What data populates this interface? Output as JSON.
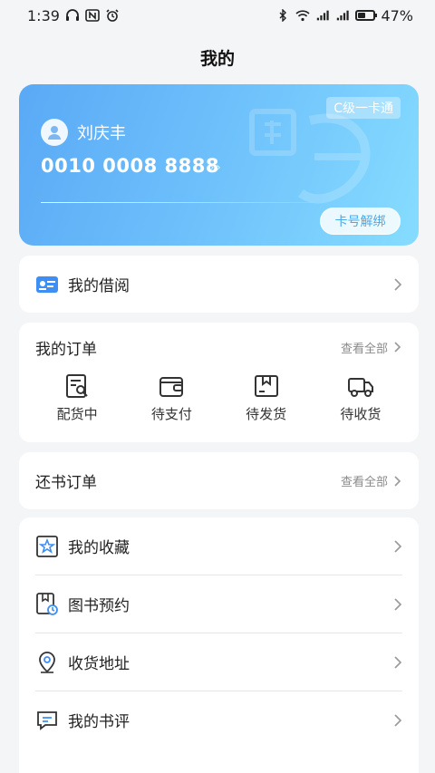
{
  "status": {
    "time": "1:39",
    "battery": "47%",
    "battery_level": 0.47
  },
  "page_title": "我的",
  "card": {
    "badge": "C级一卡通",
    "name": "刘庆丰",
    "number": "0010 0008 8888",
    "arrows": "›››",
    "unbind_label": "卡号解绑"
  },
  "borrow": {
    "label": "我的借阅",
    "icon": "id-card-icon"
  },
  "orders": {
    "title": "我的订单",
    "view_all": "查看全部",
    "items": [
      {
        "label": "配货中",
        "icon": "document-search-icon"
      },
      {
        "label": "待支付",
        "icon": "wallet-icon"
      },
      {
        "label": "待发货",
        "icon": "box-icon"
      },
      {
        "label": "待收货",
        "icon": "truck-icon"
      }
    ]
  },
  "return_orders": {
    "title": "还书订单",
    "view_all": "查看全部"
  },
  "menu": [
    {
      "label": "我的收藏",
      "icon": "star-icon"
    },
    {
      "label": "图书预约",
      "icon": "book-clock-icon"
    },
    {
      "label": "收货地址",
      "icon": "location-pin-icon"
    },
    {
      "label": "我的书评",
      "icon": "comment-icon"
    }
  ],
  "colors": {
    "accent": "#3d8ff5",
    "card_start": "#5aa9f6",
    "card_end": "#86dcff"
  }
}
